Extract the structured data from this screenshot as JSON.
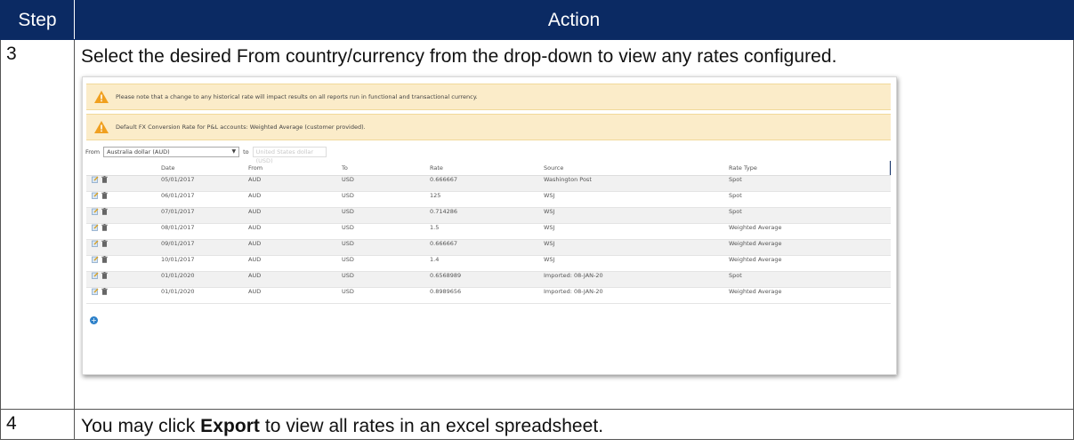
{
  "header": {
    "step": "Step",
    "action": "Action"
  },
  "steps": [
    {
      "number": "3",
      "text": "Select the desired From country/currency from the drop-down to view any rates configured."
    },
    {
      "number": "4",
      "text_before": "You may click ",
      "bold": "Export",
      "text_after": " to view all rates in an excel spreadsheet."
    }
  ],
  "screenshot": {
    "alerts": [
      "Please note that a change to any historical rate will impact results on all reports run in functional and transactional currency.",
      "Default FX Conversion Rate for P&L accounts: Weighted Average (customer provided)."
    ],
    "filter": {
      "from_label": "From",
      "from_value": "Australia dollar (AUD)",
      "to_label": "to",
      "to_value": "United States dollar (USD)"
    },
    "columns": [
      "Date",
      "From",
      "To",
      "Rate",
      "Source",
      "Rate Type"
    ],
    "rows": [
      {
        "date": "05/01/2017",
        "from": "AUD",
        "to": "USD",
        "rate": "0.666667",
        "source": "Washington Post",
        "type": "Spot"
      },
      {
        "date": "06/01/2017",
        "from": "AUD",
        "to": "USD",
        "rate": "125",
        "source": "WSJ",
        "type": "Spot"
      },
      {
        "date": "07/01/2017",
        "from": "AUD",
        "to": "USD",
        "rate": "0.714286",
        "source": "WSJ",
        "type": "Spot"
      },
      {
        "date": "08/01/2017",
        "from": "AUD",
        "to": "USD",
        "rate": "1.5",
        "source": "WSJ",
        "type": "Weighted Average"
      },
      {
        "date": "09/01/2017",
        "from": "AUD",
        "to": "USD",
        "rate": "0.666667",
        "source": "WSJ",
        "type": "Weighted Average"
      },
      {
        "date": "10/01/2017",
        "from": "AUD",
        "to": "USD",
        "rate": "1.4",
        "source": "WSJ",
        "type": "Weighted Average"
      },
      {
        "date": "01/01/2020",
        "from": "AUD",
        "to": "USD",
        "rate": "0.6568989",
        "source": "Imported: 08-JAN-20",
        "type": "Spot"
      },
      {
        "date": "01/01/2020",
        "from": "AUD",
        "to": "USD",
        "rate": "0.8989656",
        "source": "Imported: 08-JAN-20",
        "type": "Weighted Average"
      }
    ],
    "icons": {
      "edit": "edit-icon",
      "delete": "trash-icon",
      "add": "add-icon",
      "warning": "warning-icon"
    },
    "colors": {
      "header_bg": "#0b2a63",
      "alert_bg": "#fbecc9",
      "warning": "#f0a020",
      "add": "#2c80c9"
    }
  }
}
